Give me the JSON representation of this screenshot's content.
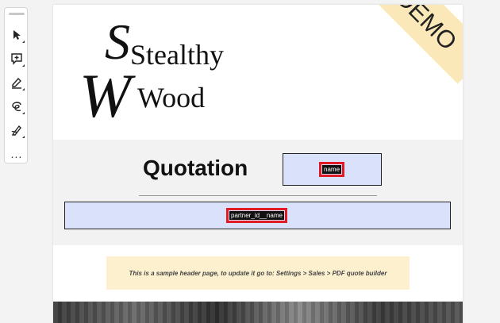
{
  "toolbar": {
    "tools": [
      {
        "name": "select-tool",
        "icon": "pointer-arrow-icon"
      },
      {
        "name": "comment-tool",
        "icon": "comment-plus-icon"
      },
      {
        "name": "highlight-tool",
        "icon": "pen-highlight-icon"
      },
      {
        "name": "draw-tool",
        "icon": "freehand-loop-icon"
      },
      {
        "name": "sign-tool",
        "icon": "pen-sign-icon"
      }
    ],
    "more_label": "..."
  },
  "document": {
    "logo": {
      "line1": "Stealthy",
      "line2": "Wood",
      "big_s": "S",
      "big_w": "W"
    },
    "ribbon": "DEMO",
    "title": "Quotation",
    "name_field": "name",
    "partner_field": "partner_id__name",
    "note": "This is a sample header page, to update it go to: Settings > Sales > PDF quote builder"
  },
  "colors": {
    "field_box": "#d9e1fb",
    "highlight": "#e01b24",
    "ribbon": "#fbe8b8",
    "note_bg": "#fdf0cf"
  }
}
